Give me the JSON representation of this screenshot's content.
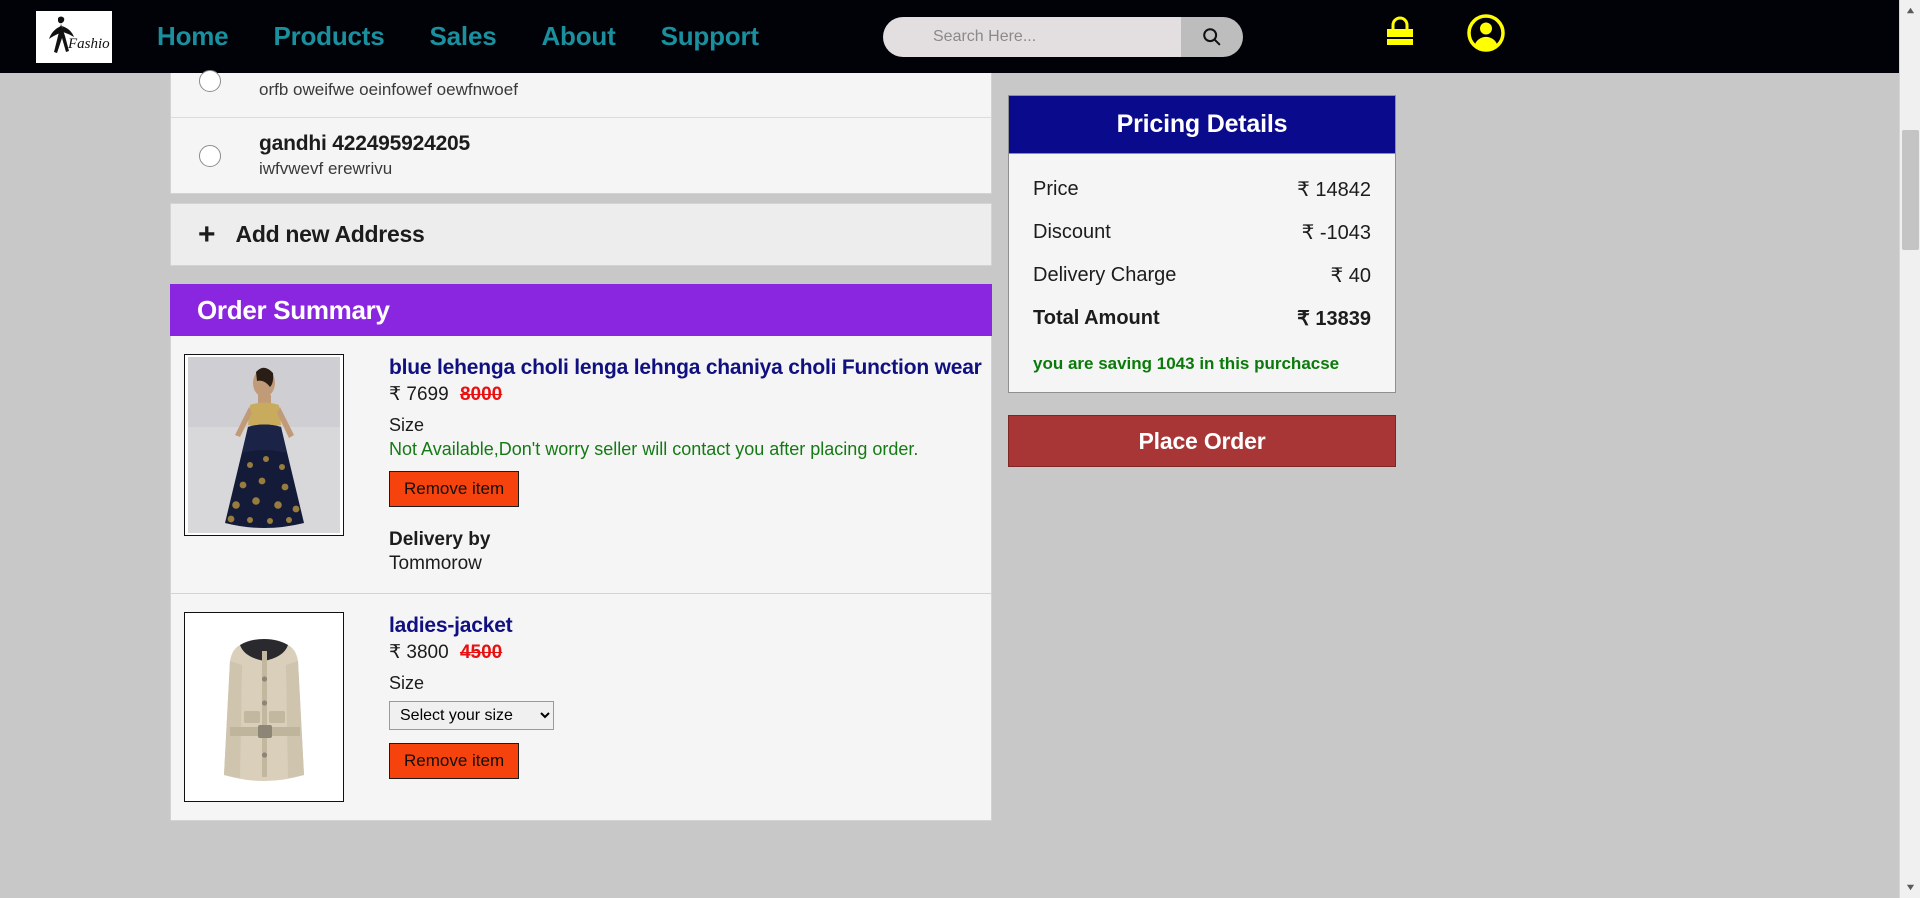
{
  "header": {
    "logo_alt": "Fashion",
    "nav": [
      {
        "label": "Home"
      },
      {
        "label": "Products"
      },
      {
        "label": "Sales"
      },
      {
        "label": "About"
      },
      {
        "label": "Support"
      }
    ],
    "search": {
      "placeholder": "Search Here...",
      "value": ""
    },
    "cart_icon": "shopping-bag-icon",
    "account_icon": "user-account-icon",
    "bg_color": "#010108",
    "nav_color": "#1a8f9e",
    "icon_color": "#ffff00"
  },
  "addresses": {
    "partial_top": {
      "detail": "orfb oweifwe oeinfowef oewfnwoef"
    },
    "items": [
      {
        "name": "gandhi 422495924205",
        "detail": "iwfvwevf erewrivu",
        "selected": false
      }
    ],
    "add_new_label": "Add new Address",
    "add_new_icon": "plus-icon"
  },
  "order_summary": {
    "title": "Order Summary",
    "header_color": "#8a25e0",
    "items": [
      {
        "title": "blue lehenga choli lenga lehnga chaniya choli Function wear",
        "currency": "₹",
        "price": "7699",
        "old_price": "8000",
        "size_label": "Size",
        "size_note": "Not Available,Don't worry seller will contact you after placing order.",
        "has_size_select": false,
        "remove_label": "Remove item",
        "delivery_title": "Delivery by",
        "delivery_value": "Tommorow"
      },
      {
        "title": "ladies-jacket",
        "currency": "₹",
        "price": "3800",
        "old_price": "4500",
        "size_label": "Size",
        "size_note": "",
        "has_size_select": true,
        "size_selected": "Select your size",
        "size_options": [
          "Select your size"
        ],
        "remove_label": "Remove item",
        "delivery_title": "",
        "delivery_value": ""
      }
    ]
  },
  "pricing": {
    "title": "Pricing Details",
    "header_color": "#0a0a8c",
    "rows": [
      {
        "label": "Price",
        "value": "₹ 14842",
        "bold": false
      },
      {
        "label": "Discount",
        "value": "₹ -1043",
        "bold": false
      },
      {
        "label": "Delivery Charge",
        "value": "₹ 40",
        "bold": false
      },
      {
        "label": "Total Amount",
        "value": "₹ 13839",
        "bold": true
      }
    ],
    "saving_note": "you are saving 1043 in this purchacse",
    "place_order_label": "Place Order",
    "place_order_color": "#a93636"
  }
}
